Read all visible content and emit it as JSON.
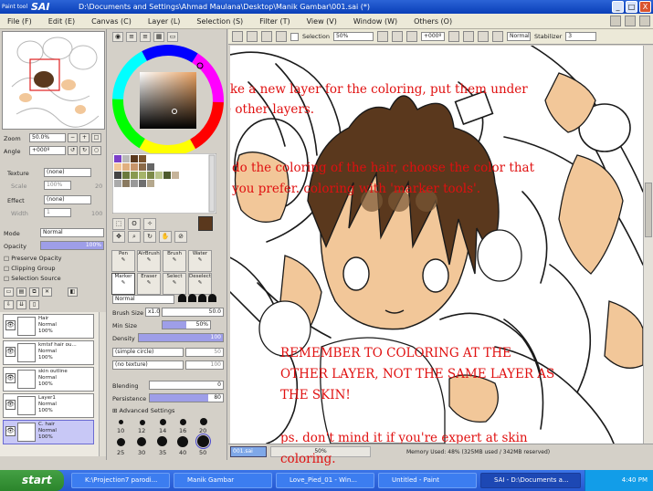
{
  "window": {
    "app_logo": "SAI",
    "app_logo_sub": "Paint tool",
    "title": "D:\\Documents and Settings\\Ahmad Maulana\\Desktop\\Manik Gambar\\001.sai (*)",
    "minimize": "_",
    "maximize": "□",
    "close": "X"
  },
  "menu": {
    "items": [
      "File (F)",
      "Edit (E)",
      "Canvas (C)",
      "Layer (L)",
      "Selection (S)",
      "Filter (T)",
      "View (V)",
      "Window (W)",
      "Others (O)"
    ]
  },
  "navigator": {
    "zoom_label": "Zoom",
    "zoom_value": "50.0%",
    "angle_label": "Angle",
    "angle_value": "+000º",
    "texture_label": "Texture",
    "texture_value": "(none)",
    "scale_label": "Scale",
    "scale_value": "100%",
    "scale_num": "20",
    "effect_label": "Effect",
    "effect_value": "(none)",
    "width_label": "Width",
    "width_value": "1",
    "width_num": "100"
  },
  "layer_options": {
    "mode_label": "Mode",
    "mode_value": "Normal",
    "opacity_label": "Opacity",
    "opacity_value": "100%",
    "preserve_opacity": "Preserve Opacity",
    "clipping_group": "Clipping Group",
    "selection_source": "Selection Source"
  },
  "layers": [
    {
      "name": "Hair",
      "mode": "Normal",
      "opacity": "100%",
      "selected": false
    },
    {
      "name": "kmtsf hair ou...",
      "mode": "Normal",
      "opacity": "100%",
      "selected": false
    },
    {
      "name": "skin outline",
      "mode": "Normal",
      "opacity": "100%",
      "selected": false
    },
    {
      "name": "Layer1",
      "mode": "Normal",
      "opacity": "100%",
      "selected": false
    },
    {
      "name": "C. hair",
      "mode": "Normal",
      "opacity": "100%",
      "selected": true
    }
  ],
  "tools": {
    "brush_row1": [
      "Pen",
      "AirBrush",
      "Brush",
      "Water"
    ],
    "brush_row2": [
      "Marker",
      "Eraser",
      "Select",
      "Deselect"
    ],
    "selected_brush": "Marker",
    "blend_value": "Normal",
    "brush_size_label": "Brush Size",
    "brush_size_mult": "x1.0",
    "brush_size_value": "50.0",
    "min_size_label": "Min Size",
    "min_size_value": "50%",
    "density_label": "Density",
    "density_value": "100",
    "shape_value": "(simple circle)",
    "texture_value": "(no texture)",
    "shape_num": "50",
    "texture_num": "100",
    "blending_label": "Blending",
    "blending_value": "0",
    "persistence_label": "Persistence",
    "persistence_value": "80",
    "advanced_label": "Advanced Settings",
    "size_presets_row1": [
      "10",
      "12",
      "14",
      "16",
      "20"
    ],
    "size_presets_row2": [
      "25",
      "30",
      "35",
      "40",
      "50"
    ]
  },
  "canvas_toolbar": {
    "selection_label": "Selection",
    "zoom_value": "50%",
    "angle_value": "+000º",
    "mode_value": "Normal",
    "stabilizer_label": "Stabilizer",
    "stabilizer_value": "3"
  },
  "canvas_notes": [
    "make a new layer for the coloring, put them under",
    "the other layers.",
    "do the coloring of the hair, choose the color that",
    "you prefer. coloring with 'marker tools'.",
    "REMEMBER TO COLORING AT THE",
    "OTHER LAYER, NOT THE SAME LAYER AS",
    "THE SKIN!",
    "ps. don't mind it if you're expert at skin",
    "coloring."
  ],
  "status": {
    "doc_name": "001.sai",
    "doc_zoom": "50%",
    "memory": "Memory Used: 48% (325MB used / 342MB reserved)"
  },
  "taskbar": {
    "start": "start",
    "tasks": [
      "K:\\Projection7 parodi...",
      "Manik Gambar",
      "Love_Pied_01 - Win...",
      "Untitled - Paint",
      "SAI - D:\\Documents a..."
    ],
    "active_task": 4,
    "clock": "4:40 PM"
  },
  "colors": {
    "note_red": "#e01010",
    "hair_brown": "#5a381d",
    "skin_tan": "#f2c799",
    "selected_layer": "#c8c8f6",
    "title_blue": "#0a3fb8"
  }
}
